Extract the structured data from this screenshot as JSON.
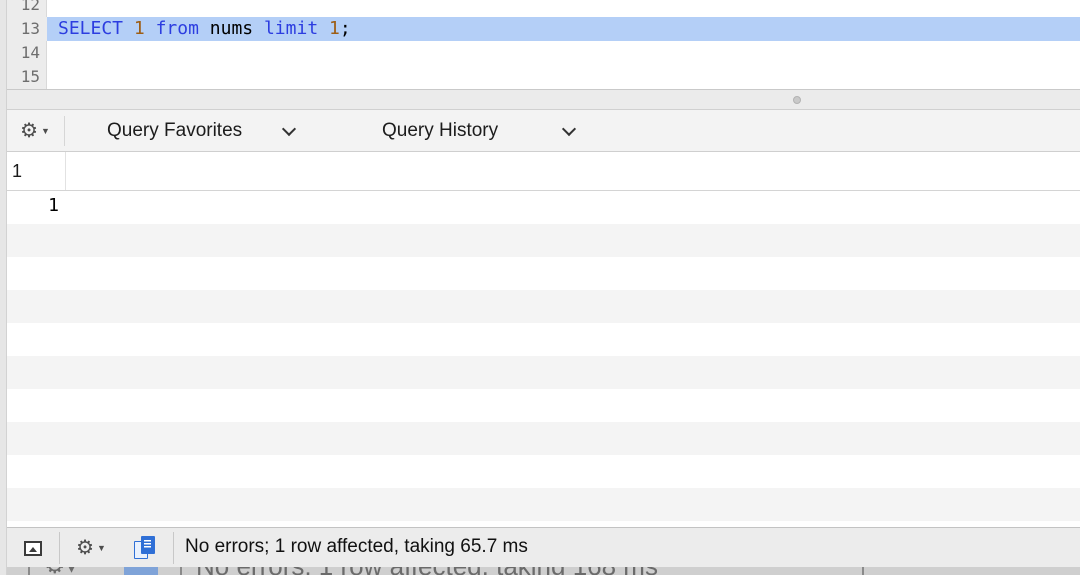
{
  "editor": {
    "lines": [
      {
        "number": "12",
        "code": ""
      },
      {
        "number": "13",
        "tokens": {
          "kw1": "SELECT",
          "n1": "1",
          "kw2": "from",
          "ident": "nums",
          "kw3": "limit",
          "n2": "1",
          "end": ";"
        }
      },
      {
        "number": "14",
        "code": ""
      },
      {
        "number": "15",
        "code": ""
      }
    ],
    "colors": {
      "keyword": "#2c3de0",
      "number": "#9d5d14",
      "selection": "#b4cff7"
    }
  },
  "query_bar": {
    "gear_icon": "gear-icon",
    "favorites_label": "Query Favorites",
    "history_label": "Query History"
  },
  "results": {
    "columns": [
      "1"
    ],
    "rows": [
      [
        "1"
      ]
    ]
  },
  "status_bar": {
    "toggle_icon": "panel-toggle-icon",
    "gear_icon": "gear-icon",
    "copy_icon": "copy-icon",
    "message": "No errors; 1 row affected, taking 65.7 ms"
  },
  "background_window": {
    "message": "No errors; 1 row affected, taking 168 ms"
  }
}
